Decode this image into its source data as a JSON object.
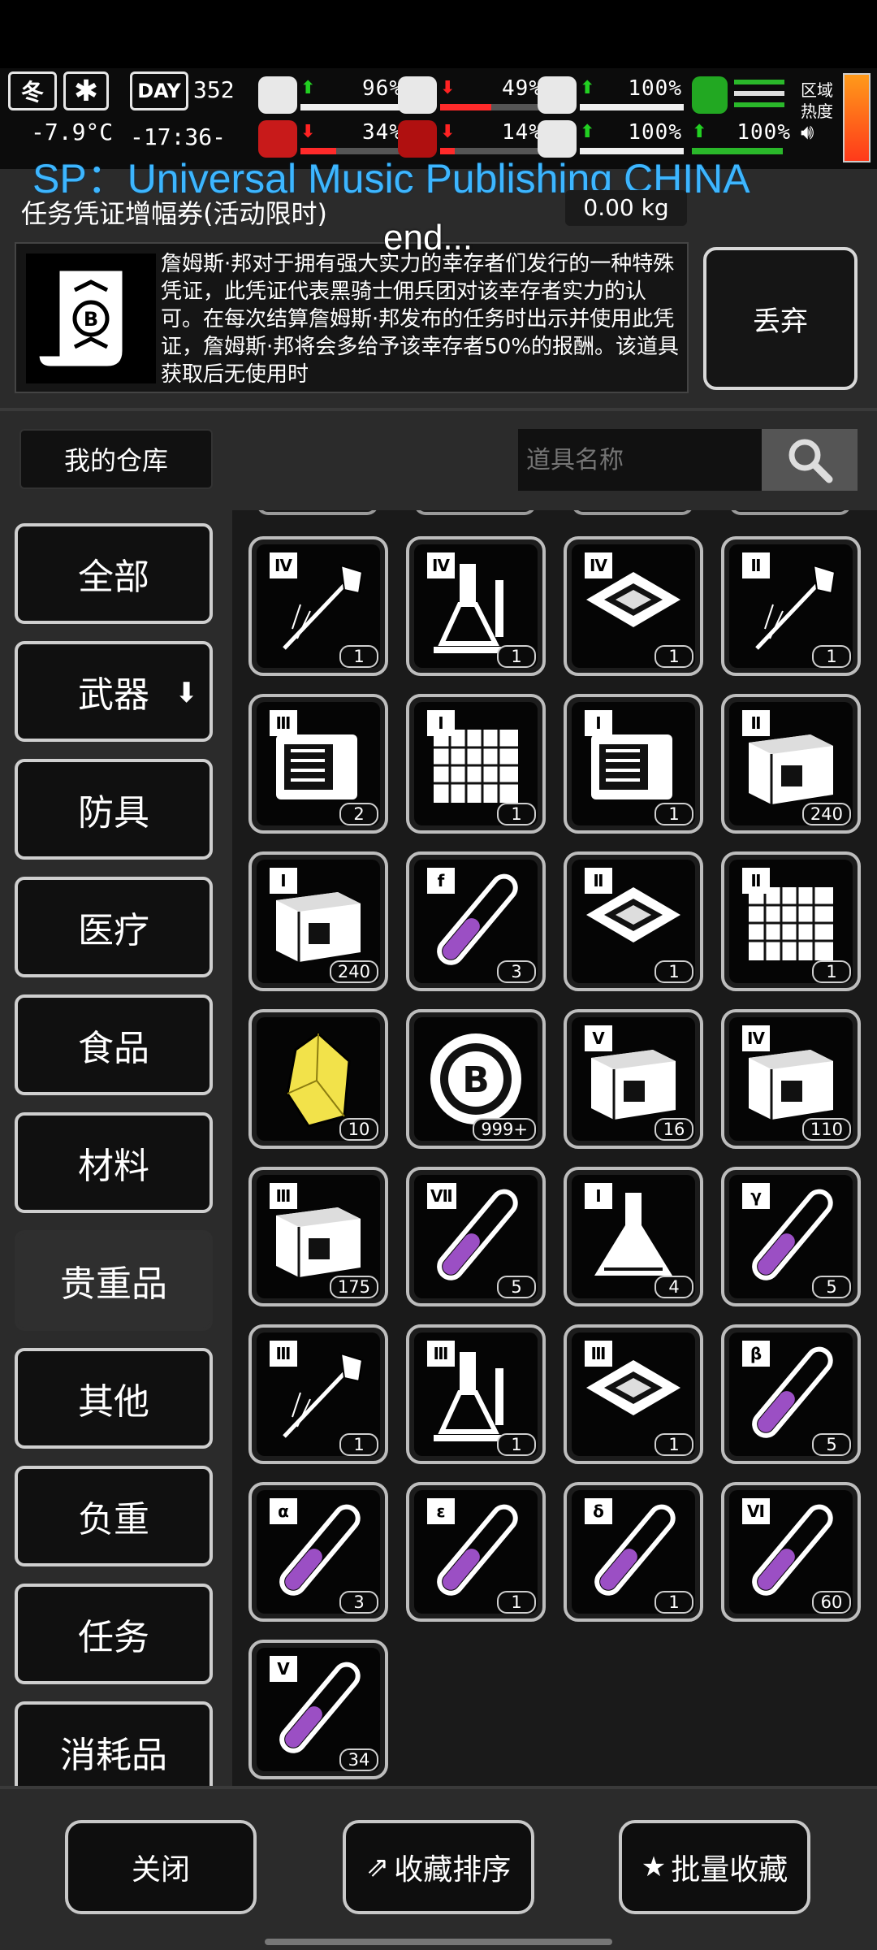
{
  "hud": {
    "season": "冬",
    "day_label": "DAY",
    "day": "352",
    "temperature": "-7.9°C",
    "clock": "-17:36-",
    "stats_top": [
      {
        "name": "health",
        "icon": "medkit-icon",
        "trend": "up",
        "value": "96%",
        "fraction": 0.96
      },
      {
        "name": "stomach",
        "icon": "stomach-icon",
        "trend": "down",
        "value": "49%",
        "fraction": 0.49
      },
      {
        "name": "stamina",
        "icon": "pill-icon",
        "trend": "up",
        "value": "100%",
        "fraction": 1.0
      }
    ],
    "stats_bottom": [
      {
        "name": "brain",
        "icon": "brain-icon",
        "trend": "down",
        "value": "34%",
        "fraction": 0.34
      },
      {
        "name": "water",
        "icon": "blood-drop-icon",
        "trend": "down",
        "value": "14%",
        "fraction": 0.14
      },
      {
        "name": "mood",
        "icon": "heart-icon",
        "trend": "up",
        "value": "100%",
        "fraction": 1.0
      }
    ],
    "extra_stat": {
      "value": "100%",
      "trend": "up"
    },
    "zone_label_1": "区域",
    "zone_label_2": "热度"
  },
  "overlay": {
    "title": "SP：Universal Music Publishing CHINA",
    "end_text": "end..."
  },
  "item": {
    "name": "任务凭证增幅券(活动限时)",
    "weight": "0.00 kg",
    "description": "詹姆斯·邦对于拥有强大实力的幸存者们发行的一种特殊凭证，此凭证代表黑骑士佣兵团对该幸存者实力的认可。在每次结算詹姆斯·邦发布的任务时出示并使用此凭证，詹姆斯·邦将会多给予该幸存者50%的报酬。该道具获取后无使用时",
    "discard_label": "丢弃"
  },
  "storage": {
    "tab_label": "我的仓库",
    "search_placeholder": "道具名称"
  },
  "categories": [
    {
      "label": "全部",
      "active": false
    },
    {
      "label": "武器",
      "active": false,
      "dropdown": true
    },
    {
      "label": "防具",
      "active": false
    },
    {
      "label": "医疗",
      "active": false
    },
    {
      "label": "食品",
      "active": false
    },
    {
      "label": "材料",
      "active": false
    },
    {
      "label": "贵重品",
      "active": true
    },
    {
      "label": "其他",
      "active": false
    },
    {
      "label": "负重",
      "active": false
    },
    {
      "label": "任务",
      "active": false
    },
    {
      "label": "消耗品",
      "active": false
    }
  ],
  "items": [
    {
      "kind": "syringe",
      "tier": "Ⅳ",
      "count": "1",
      "icon": "syringe-icon"
    },
    {
      "kind": "chem",
      "tier": "Ⅳ",
      "count": "1",
      "icon": "chemistry-set-icon"
    },
    {
      "kind": "chip",
      "tier": "Ⅳ",
      "count": "1",
      "icon": "microchip-icon"
    },
    {
      "kind": "syringe",
      "tier": "Ⅱ",
      "count": "1",
      "icon": "syringe-icon"
    },
    {
      "kind": "device",
      "tier": "Ⅲ",
      "count": "2",
      "icon": "device-icon"
    },
    {
      "kind": "board",
      "tier": "Ⅰ",
      "count": "1",
      "icon": "circuit-board-icon"
    },
    {
      "kind": "device",
      "tier": "Ⅰ",
      "count": "1",
      "icon": "device-icon"
    },
    {
      "kind": "crate",
      "tier": "Ⅱ",
      "count": "240",
      "icon": "crate-icon"
    },
    {
      "kind": "crate",
      "tier": "Ⅰ",
      "count": "240",
      "icon": "crate-icon"
    },
    {
      "kind": "tube",
      "tier": "f",
      "count": "3",
      "icon": "test-tube-icon"
    },
    {
      "kind": "chip",
      "tier": "Ⅱ",
      "count": "1",
      "icon": "microchip-icon"
    },
    {
      "kind": "board",
      "tier": "Ⅱ",
      "count": "1",
      "icon": "circuit-board-icon"
    },
    {
      "kind": "gem",
      "tier": "",
      "count": "10",
      "icon": "gold-ore-icon"
    },
    {
      "kind": "coin",
      "tier": "",
      "count": "999+",
      "icon": "bitcoin-token-icon"
    },
    {
      "kind": "crate",
      "tier": "Ⅴ",
      "count": "16",
      "icon": "crate-icon"
    },
    {
      "kind": "crate",
      "tier": "Ⅳ",
      "count": "110",
      "icon": "crate-icon"
    },
    {
      "kind": "crate",
      "tier": "Ⅲ",
      "count": "175",
      "icon": "crate-icon"
    },
    {
      "kind": "tube",
      "tier": "Ⅶ",
      "count": "5",
      "icon": "test-tube-icon"
    },
    {
      "kind": "flask",
      "tier": "Ⅰ",
      "count": "4",
      "icon": "flask-icon"
    },
    {
      "kind": "tube",
      "tier": "γ",
      "count": "5",
      "icon": "test-tube-icon"
    },
    {
      "kind": "syringe",
      "tier": "Ⅲ",
      "count": "1",
      "icon": "syringe-icon"
    },
    {
      "kind": "chem",
      "tier": "Ⅲ",
      "count": "1",
      "icon": "chemistry-set-icon"
    },
    {
      "kind": "chip",
      "tier": "Ⅲ",
      "count": "1",
      "icon": "microchip-icon"
    },
    {
      "kind": "tube",
      "tier": "β",
      "count": "5",
      "icon": "test-tube-icon"
    },
    {
      "kind": "tube",
      "tier": "α",
      "count": "3",
      "icon": "test-tube-icon"
    },
    {
      "kind": "tube",
      "tier": "ε",
      "count": "1",
      "icon": "test-tube-icon"
    },
    {
      "kind": "tube",
      "tier": "δ",
      "count": "1",
      "icon": "test-tube-icon"
    },
    {
      "kind": "tube",
      "tier": "Ⅵ",
      "count": "60",
      "icon": "test-tube-icon"
    },
    {
      "kind": "tube",
      "tier": "Ⅴ",
      "count": "34",
      "icon": "test-tube-icon"
    }
  ],
  "bottom": {
    "close_label": "关闭",
    "sort_label": "收藏排序",
    "batch_label": "批量收藏"
  },
  "colors": {
    "accent_blue": "#3db6ff",
    "up_green": "#22d022",
    "down_red": "#ff2222",
    "potion_purple": "#9b4fc4",
    "gem_yellow": "#f2e24a"
  }
}
